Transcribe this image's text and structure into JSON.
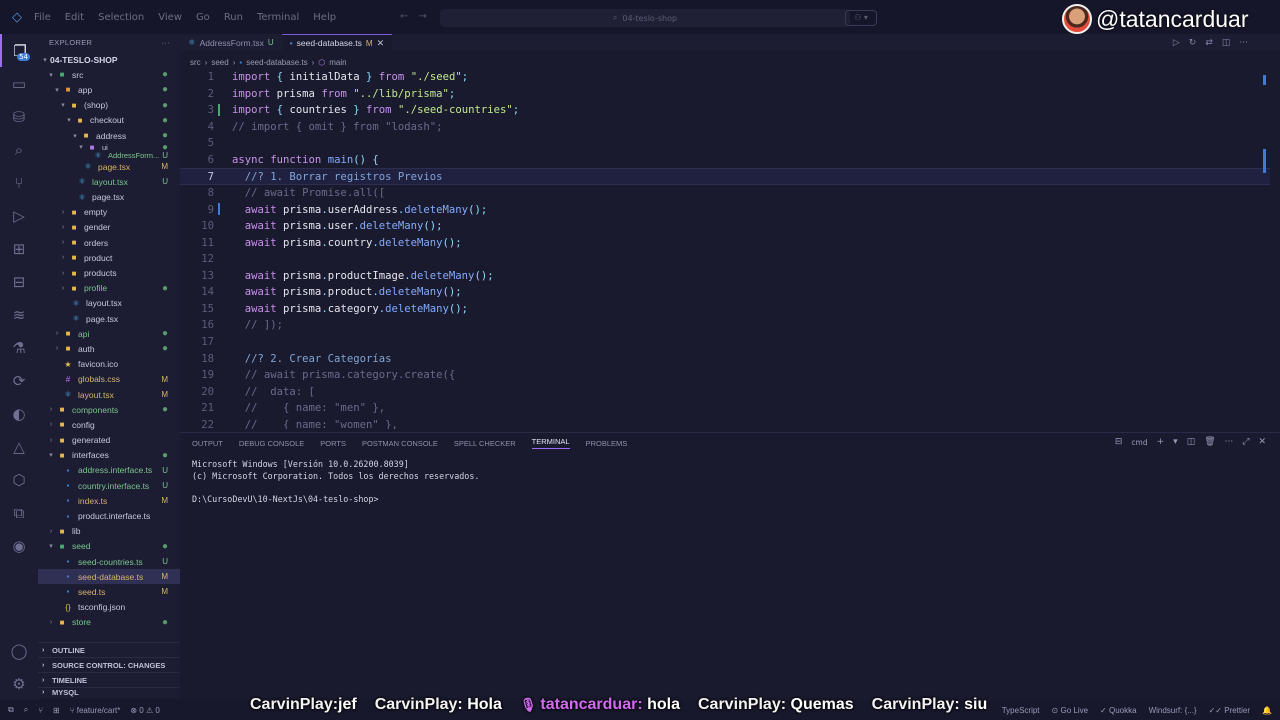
{
  "titlebar": {
    "menu": [
      "File",
      "Edit",
      "Selection",
      "View",
      "Go",
      "Run",
      "Terminal",
      "Help"
    ],
    "search": "04-teslo-shop",
    "handle": "@tatancarduar"
  },
  "sidebar": {
    "title": "EXPLORER",
    "project": "04-TESLO-SHOP",
    "sections": [
      "OUTLINE",
      "SOURCE CONTROL: CHANGES",
      "TIMELINE",
      "MYSQL"
    ]
  },
  "tabs": [
    {
      "label": "AddressForm.tsx",
      "badge": "U"
    },
    {
      "label": "seed-database.ts",
      "badge": "M"
    }
  ],
  "breadcrumb": [
    "src",
    "seed",
    "seed-database.ts",
    "main"
  ],
  "code": {
    "lines": [
      "import { initialData } from \"./seed\";",
      "import prisma from \"../lib/prisma\";",
      "import { countries } from \"./seed-countries\";",
      "// import { omit } from \"lodash\";",
      "",
      "async function main() {",
      "  //? 1. Borrar registros Previos",
      "  // await Promise.all([",
      "  await prisma.userAddress.deleteMany();",
      "  await prisma.user.deleteMany();",
      "  await prisma.country.deleteMany();",
      "",
      "  await prisma.productImage.deleteMany();",
      "  await prisma.product.deleteMany();",
      "  await prisma.category.deleteMany();",
      "  // ]);",
      "",
      "  //? 2. Crear Categorías",
      "  // await prisma.category.create({",
      "  //  data: [",
      "  //    { name: \"men\" },",
      "  //    { name: \"women\" },"
    ],
    "current_line": 7
  },
  "panel": {
    "tabs": [
      "OUTPUT",
      "DEBUG CONSOLE",
      "PORTS",
      "POSTMAN CONSOLE",
      "SPELL CHECKER",
      "TERMINAL",
      "PROBLEMS"
    ],
    "active_tab": "TERMINAL",
    "shell": "cmd",
    "terminal_lines": [
      "Microsoft Windows [Versión 10.0.26200.8039]",
      "(c) Microsoft Corporation. Todos los derechos reservados.",
      "",
      "D:\\CursoDevU\\10-NextJs\\04-teslo-shop>"
    ]
  },
  "statusbar": {
    "branch": "feature/cart*",
    "errors": "0",
    "warnings": "0",
    "language": "TypeScript",
    "go_live": "Go Live",
    "quokka": "Quokka",
    "windsurf": "Windsurf: {...}",
    "prettier": "Prettier"
  },
  "chat": [
    {
      "user": "CarvinPlay:",
      "msg": "jef",
      "host": false
    },
    {
      "user": "CarvinPlay:",
      "msg": "Hola",
      "host": false
    },
    {
      "user": "tatancarduar:",
      "msg": "hola",
      "host": true
    },
    {
      "user": "CarvinPlay:",
      "msg": "Quemas",
      "host": false
    },
    {
      "user": "CarvinPlay:",
      "msg": "siu",
      "host": false
    }
  ],
  "colors": {
    "accent": "#9b6dff",
    "modified": "#d8b46a",
    "untracked": "#7cc68c"
  }
}
